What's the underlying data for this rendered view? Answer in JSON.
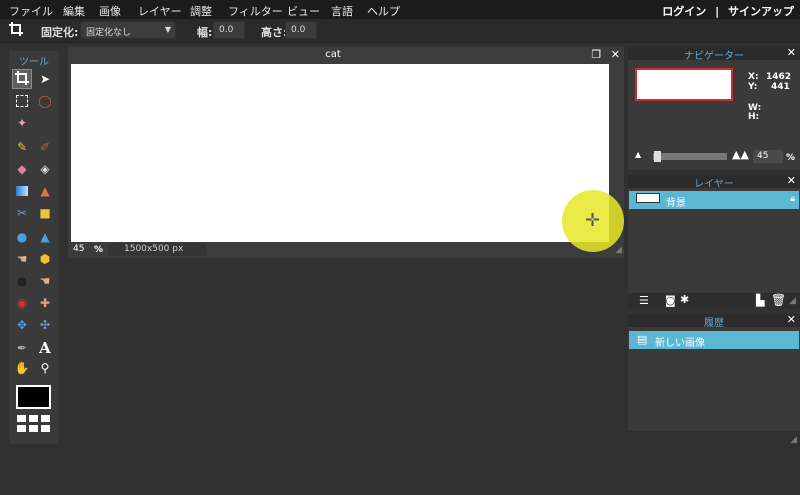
{
  "menu": [
    "ファイル",
    "編集",
    "画像",
    "レイヤー",
    "調整",
    "フィルター",
    "ビュー",
    "言語",
    "ヘルプ"
  ],
  "auth": {
    "login": "ログイン",
    "sep": "|",
    "signup": "サインアップ"
  },
  "options": {
    "fixed_label": "固定化:",
    "fixed_value": "固定化なし",
    "width_label": "幅:",
    "width_value": "0.0",
    "height_label": "高さ:",
    "height_value": "0.0"
  },
  "tools": {
    "title": "ツール",
    "icons": [
      "crop-icon",
      "move-icon",
      "marquee-icon",
      "lasso-icon",
      "magic-wand-icon",
      "pencil-icon",
      "brush-icon",
      "eraser-icon",
      "paint-bucket-icon",
      "gradient-icon",
      "stamp-icon",
      "color-replace-icon",
      "drawing-icon",
      "blur-icon",
      "sharpen-icon",
      "smudge-icon",
      "sponge-icon",
      "dodge-icon",
      "burn-icon",
      "red-eye-icon",
      "spot-heal-icon",
      "bloat-icon",
      "pinch-icon",
      "color-picker-icon",
      "type-icon",
      "hand-icon",
      "zoom-icon"
    ],
    "foreground_color": "#000000"
  },
  "document": {
    "title": "cat",
    "zoom": "45",
    "zoom_unit": "%",
    "dimensions": "1500x500 px"
  },
  "navigator": {
    "title": "ナビゲーター",
    "x_label": "X:",
    "x_value": "1462",
    "y_label": "Y:",
    "y_value": "441",
    "w_label": "W:",
    "h_label": "H:",
    "zoom": "45",
    "zoom_unit": "%"
  },
  "layers": {
    "title": "レイヤー",
    "items": [
      {
        "name": "背景"
      }
    ]
  },
  "history": {
    "title": "履歴",
    "items": [
      {
        "label": "新しい画像"
      }
    ]
  },
  "colors": {
    "accent": "#5bb7d3",
    "panel_title": "#5fa8d8",
    "cursor_highlight": "#e8e828"
  }
}
